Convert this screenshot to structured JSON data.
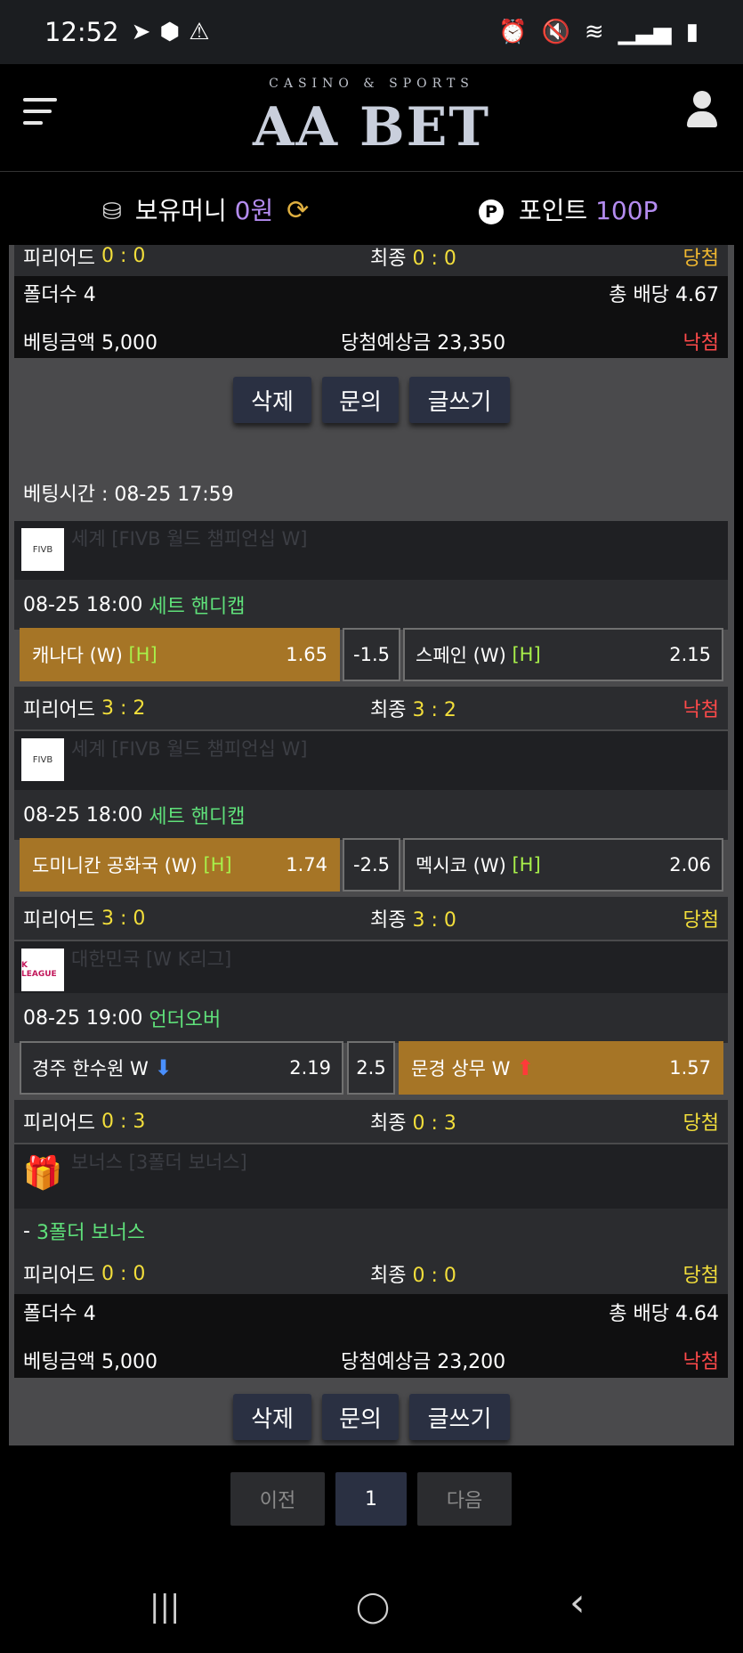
{
  "status_bar": {
    "time": "12:52",
    "icons": [
      "telegram-icon",
      "n-badge-icon",
      "warning-icon",
      "alarm-icon",
      "mute-icon",
      "wifi-icon",
      "signal-icon",
      "battery-icon"
    ]
  },
  "header": {
    "tagline": "CASINO & SPORTS",
    "logo": "AA BET"
  },
  "balance": {
    "money_label": "보유머니",
    "money_value": "0원",
    "points_label": "포인트",
    "points_value": "100P",
    "points_badge": "P"
  },
  "colors": {
    "win": "#f2de3b",
    "lose": "#ff4a4a",
    "market": "#5fe07a",
    "selected": "#a67526",
    "button": "#2a3042"
  },
  "bet_slips": [
    {
      "partial_top": {
        "period_label": "피리어드",
        "period_score": "0 : 0",
        "final_label": "최종",
        "final_score": "0 : 0",
        "result": "당첨"
      },
      "summary": {
        "folders_label": "폴더수 4",
        "total_odds_label": "총 배당 4.67",
        "bet_amount_label": "베팅금액 5,000",
        "expected_label": "당첨예상금 23,350",
        "status": "낙첨"
      },
      "actions": {
        "delete": "삭제",
        "inquiry": "문의",
        "write": "글쓰기"
      }
    },
    {
      "bet_time": "베팅시간 : 08-25 17:59",
      "matches": [
        {
          "league": "세계 [FIVB 월드 챔피언십 W]",
          "league_logo": "FIVB",
          "datetime": "08-25 18:00",
          "market": "세트 핸디캡",
          "home": {
            "name": "캐나다 (W)",
            "tag": "[H]",
            "odds": "1.65",
            "selected": true
          },
          "line": "-1.5",
          "away": {
            "name": "스페인 (W)",
            "tag": "[H]",
            "odds": "2.15",
            "selected": false
          },
          "period_label": "피리어드",
          "period_score": "3 : 2",
          "final_label": "최종",
          "final_score": "3 : 2",
          "result": "낙첨"
        },
        {
          "league": "세계 [FIVB 월드 챔피언십 W]",
          "league_logo": "FIVB",
          "datetime": "08-25 18:00",
          "market": "세트 핸디캡",
          "home": {
            "name": "도미니칸 공화국 (W)",
            "tag": "[H]",
            "odds": "1.74",
            "selected": true
          },
          "line": "-2.5",
          "away": {
            "name": "멕시코 (W)",
            "tag": "[H]",
            "odds": "2.06",
            "selected": false
          },
          "period_label": "피리어드",
          "period_score": "3 : 0",
          "final_label": "최종",
          "final_score": "3 : 0",
          "result": "당첨"
        },
        {
          "league": "대한민국 [W K리그]",
          "league_logo": "K LEAGUE",
          "datetime": "08-25 19:00",
          "market": "언더오버",
          "home": {
            "name": "경주 한수원 W",
            "arrow": "arrow-down-icon",
            "odds": "2.19",
            "selected": false
          },
          "line": "2.5",
          "away": {
            "name": "문경 상무 W",
            "arrow": "arrow-up-icon",
            "odds": "1.57",
            "selected": true
          },
          "period_label": "피리어드",
          "period_score": "0 : 3",
          "final_label": "최종",
          "final_score": "0 : 3",
          "result": "당첨"
        }
      ],
      "bonus": {
        "league": "보너스 [3폴더 보너스]",
        "line": "3폴더 보너스",
        "prefix": "-",
        "period_label": "피리어드",
        "period_score": "0 : 0",
        "final_label": "최종",
        "final_score": "0 : 0",
        "result": "당첨"
      },
      "summary": {
        "folders_label": "폴더수 4",
        "total_odds_label": "총 배당 4.64",
        "bet_amount_label": "베팅금액 5,000",
        "expected_label": "당첨예상금 23,200",
        "status": "낙첨"
      },
      "actions": {
        "delete": "삭제",
        "inquiry": "문의",
        "write": "글쓰기"
      }
    }
  ],
  "pagination": {
    "prev": "이전",
    "current": "1",
    "next": "다음"
  },
  "nav_bar": {
    "recent": "|||",
    "home": "◯",
    "back": "‹"
  }
}
